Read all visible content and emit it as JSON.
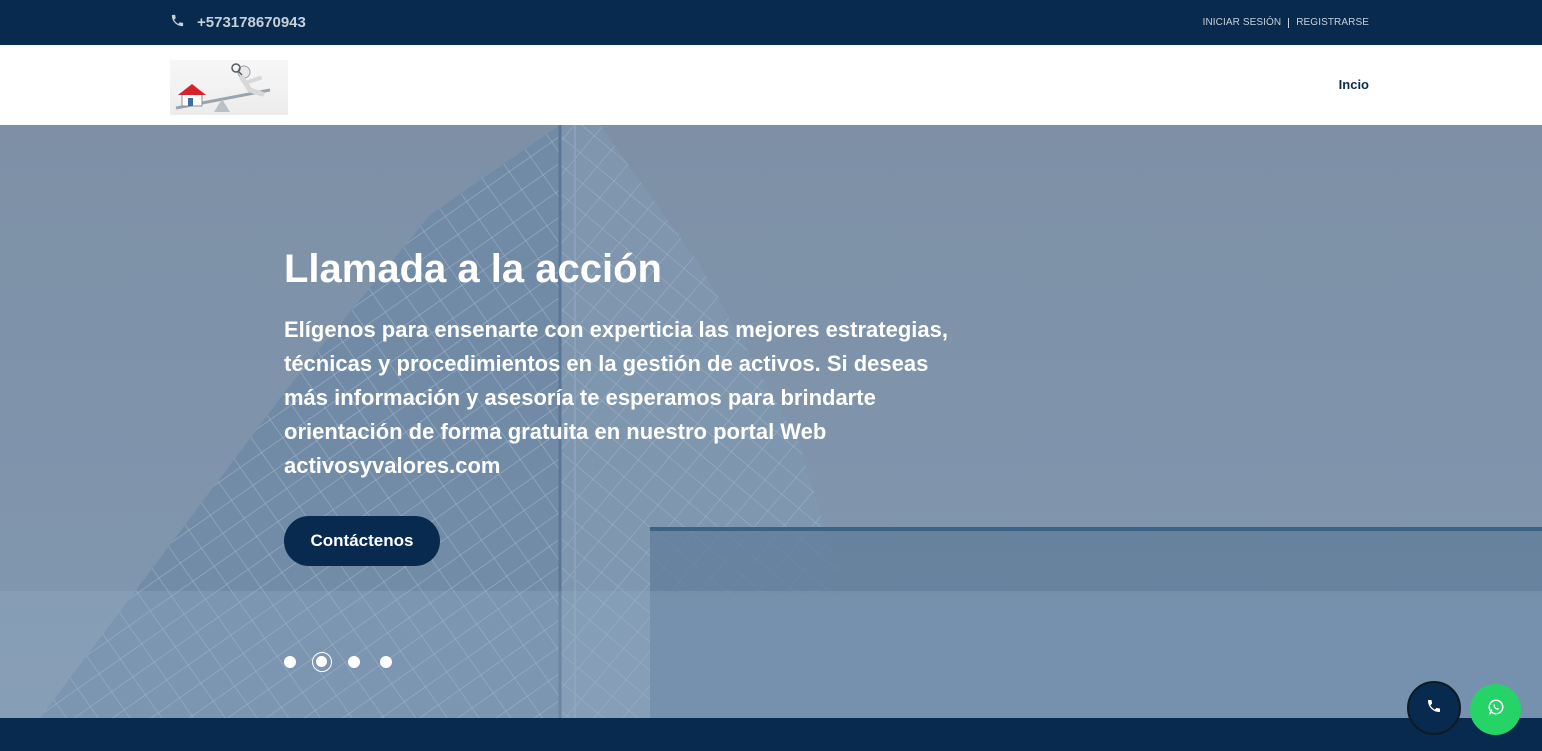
{
  "topbar": {
    "phone": "+573178670943",
    "phone_icon": "phone-icon",
    "login_label": "INICIAR SESIÓN",
    "register_label": "REGISTRARSE"
  },
  "header": {
    "logo_icon": "logo-house-balance-icon",
    "nav": [
      {
        "label": "Incio"
      }
    ]
  },
  "hero": {
    "title": "Llamada a la acción",
    "text": "Elígenos para ensenarte con experticia las mejores estrategias, técnicas y procedimientos en la gestión de activos. Si deseas más información y asesoría te esperamos para brindarte orientación de forma gratuita en nuestro portal Web activosyvalores.com",
    "cta_label": "Contáctenos",
    "slides": 4,
    "active_slide": 2
  },
  "floating": {
    "call_icon": "phone-icon",
    "whatsapp_icon": "whatsapp-icon"
  },
  "colors": {
    "navy": "#082a4f",
    "hero_overlay": "#7b8fa5",
    "whatsapp": "#25d366",
    "white": "#ffffff"
  }
}
